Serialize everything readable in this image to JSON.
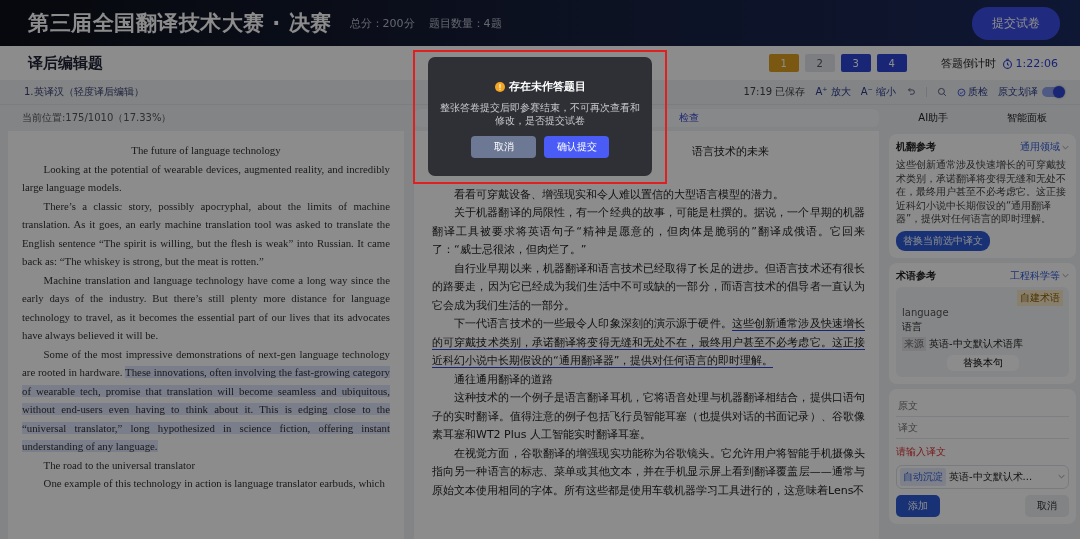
{
  "header": {
    "title": "第三届全国翻译技术大赛 · 决赛",
    "total_score": "总分：200分",
    "question_count": "题目数量：4题",
    "submit_button": "提交试卷"
  },
  "subheader": {
    "title": "译后编辑题",
    "questions": [
      {
        "label": "1",
        "selected": true,
        "answered": false
      },
      {
        "label": "2",
        "selected": false,
        "answered": false
      },
      {
        "label": "3",
        "selected": false,
        "answered": true
      },
      {
        "label": "4",
        "selected": false,
        "answered": true
      }
    ],
    "countdown_label": "答题倒计时",
    "countdown": "1:22:06"
  },
  "question": {
    "title": "1.英译汉（轻度译后编辑）",
    "saved": "17:19 已保存",
    "tools": [
      {
        "kind": "zoom-in",
        "icon": "A⁺",
        "label": "放大"
      },
      {
        "kind": "zoom-out",
        "icon": "A⁻",
        "label": "缩小"
      },
      {
        "kind": "undo"
      },
      {
        "kind": "divider"
      },
      {
        "kind": "search"
      },
      {
        "kind": "check",
        "label": "质检"
      }
    ],
    "toggle": {
      "label": "原文划译",
      "on": true
    }
  },
  "source": {
    "position": "当前位置:175/1010（17.33%）",
    "paragraphs": [
      {
        "kind": "title",
        "segments": [
          {
            "text": "The future of language technology",
            "highlighted": false
          }
        ]
      },
      {
        "kind": "paragraph",
        "segments": [
          {
            "text": "Looking at the potential of wearable devices, augmented reality, and incredibly large language models.",
            "highlighted": false
          }
        ]
      },
      {
        "kind": "paragraph",
        "segments": [
          {
            "text": "There’s a classic story, possibly apocryphal, about the limits of machine translation. As it goes, an early machine translation tool was asked to translate the English sentence “The spirit is willing, but the flesh is weak” into Russian. It came back as: “The whiskey is strong, but the meat is rotten.”",
            "highlighted": false
          }
        ]
      },
      {
        "kind": "paragraph",
        "segments": [
          {
            "text": "Machine translation and language technology have come a long way since the early days of the industry. But there’s still plenty more distance for language technology to travel, as it becomes the essential part of our lives that its advocates have always believed it will be.",
            "highlighted": false
          }
        ]
      },
      {
        "kind": "paragraph",
        "segments": [
          {
            "text": "Some of the most impressive demonstrations of next-gen language technology are rooted in hardware. ",
            "highlighted": false
          },
          {
            "text": "These innovations, often involving the fast-growing category of wearable tech, promise that translation will become seamless and ubiquitous, without end-users even having to think about it. This is edging close to the “universal translator,” long hypothesized in science fiction, offering instant understanding of any language.",
            "highlighted": true
          }
        ]
      },
      {
        "kind": "heading",
        "segments": [
          {
            "text": "The road to the universal translator",
            "highlighted": false
          }
        ]
      },
      {
        "kind": "paragraph",
        "segments": [
          {
            "text": "One example of this technology in action is language translator earbuds, which",
            "highlighted": false
          }
        ]
      }
    ]
  },
  "target": {
    "search_hint": "检查",
    "paragraphs": [
      {
        "kind": "title",
        "segments": [
          {
            "text": "语言技术的未来",
            "highlighted": false
          }
        ]
      },
      {
        "kind": "paragraph",
        "segments": [
          {
            "text": "看看可穿戴设备、增强现实和令人难以置信的大型语言模型的潜力。",
            "highlighted": false
          }
        ]
      },
      {
        "kind": "paragraph",
        "segments": [
          {
            "text": "关于机器翻译的局限性，有一个经典的故事，可能是杜撰的。据说，一个早期的机器翻译工具被要求将英语句子“精神是愿意的，但肉体是脆弱的”翻译成俄语。它回来了：“威士忌很浓，但肉烂了。”",
            "highlighted": false
          }
        ]
      },
      {
        "kind": "paragraph",
        "segments": [
          {
            "text": "自行业早期以来，机器翻译和语言技术已经取得了长足的进步。但语言技术还有很长的路要走，因为它已经成为我们生活中不可或缺的一部分，而语言技术的倡导者一直认为它会成为我们生活的一部分。",
            "highlighted": false
          }
        ]
      },
      {
        "kind": "paragraph",
        "segments": [
          {
            "text": "下一代语言技术的一些最令人印象深刻的演示源于硬件。",
            "highlighted": false
          },
          {
            "text": "这些创新通常涉及快速增长的可穿戴技术类别，承诺翻译将变得无缝和无处不在，最终用户甚至不必考虑它。这正接近科幻小说中长期假设的“通用翻译器”，提供对任何语言的即时理解。",
            "highlighted": true
          }
        ]
      },
      {
        "kind": "heading",
        "segments": [
          {
            "text": "通往通用翻译的道路",
            "highlighted": false
          }
        ]
      },
      {
        "kind": "paragraph",
        "segments": [
          {
            "text": "这种技术的一个例子是语言翻译耳机，它将语音处理与机器翻译相结合，提供口语句子的实时翻译。值得注意的例子包括飞行员智能耳塞（也提供对话的书面记录）、谷歌像素耳塞和WT2 Plus 人工智能实时翻译耳塞。",
            "highlighted": false
          }
        ]
      },
      {
        "kind": "paragraph",
        "segments": [
          {
            "text": "在视觉方面，谷歌翻译的增强现实功能称为谷歌镜头。它允许用户将智能手机摄像头指向另一种语言的标志、菜单或其他文本，并在手机显示屏上看到翻译覆盖层——通常与原始文本使用相同的字体。所有这些都是使用车载机器学习工具进行的，这意味着Lens不",
            "highlighted": false
          }
        ]
      }
    ]
  },
  "side_tabs": [
    "AI助手",
    "智能面板"
  ],
  "mt_reference": {
    "title": "机翻参考",
    "domain": "通用领域",
    "text": "这些创新通常涉及快速增长的可穿戴技术类别，承诺翻译将变得无缝和无处不在，最终用户甚至不必考虑它。这正接近科幻小说中长期假设的“通用翻译器”，提供对任何语言的即时理解。",
    "button": "替换当前选中译文"
  },
  "term_reference": {
    "title": "术语参考",
    "domain": "工程科学等",
    "term": {
      "badge": "自建术语",
      "source": "language",
      "target": "语言",
      "origin_tag": "来源",
      "origin": "英语-中文默认术语库",
      "button": "替换本句"
    }
  },
  "term_form": {
    "source_placeholder": "原文",
    "target_placeholder": "译文",
    "error": "请输入译文",
    "select_tag": "自动沉淀",
    "select_value": "英语-中文默认术...",
    "add_button": "添加",
    "cancel_button": "取消"
  },
  "modal": {
    "title": "存在未作答题目",
    "message": "整张答卷提交后即参赛结束，不可再次查看和修改，是否提交试卷",
    "cancel_button": "取消",
    "confirm_button": "确认提交"
  }
}
